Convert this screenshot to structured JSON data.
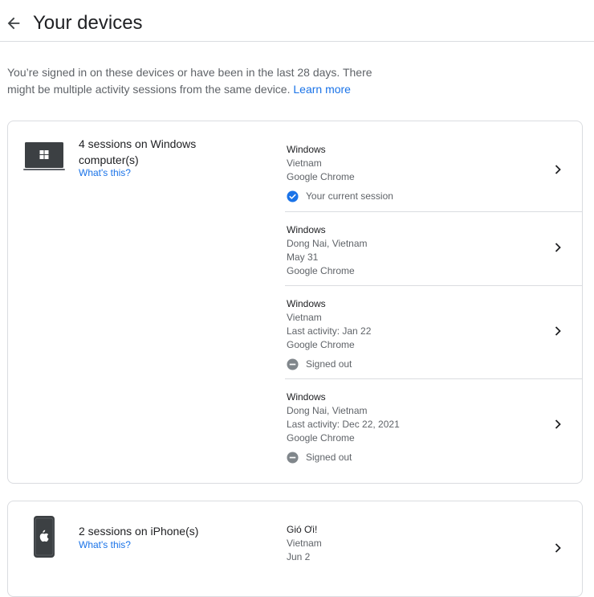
{
  "header": {
    "title": "Your devices"
  },
  "intro": {
    "text": "You’re signed in on these devices or have been in the last 28 days. There might be multiple activity sessions from the same device. ",
    "learn_more": "Learn more"
  },
  "devices": [
    {
      "title": "4 sessions on Windows computer(s)",
      "whats_this": "What's this?",
      "icon": "laptop-windows-icon",
      "sessions": [
        {
          "os": "Windows",
          "lines": [
            "Vietnam",
            "Google Chrome"
          ],
          "status": "Your current session",
          "status_icon": "check-circle-icon"
        },
        {
          "os": "Windows",
          "lines": [
            "Dong Nai, Vietnam",
            "May 31",
            "Google Chrome"
          ]
        },
        {
          "os": "Windows",
          "lines": [
            "Vietnam",
            "Last activity: Jan 22",
            "Google Chrome"
          ],
          "status": "Signed out",
          "status_icon": "minus-circle-icon"
        },
        {
          "os": "Windows",
          "lines": [
            "Dong Nai, Vietnam",
            "Last activity: Dec 22, 2021",
            "Google Chrome"
          ],
          "status": "Signed out",
          "status_icon": "minus-circle-icon"
        }
      ]
    },
    {
      "title": "2 sessions on iPhone(s)",
      "whats_this": "What's this?",
      "icon": "iphone-icon",
      "sessions": [
        {
          "os": "Gió Ơi!",
          "lines": [
            "Vietnam",
            "Jun 2"
          ]
        }
      ]
    }
  ],
  "colors": {
    "link": "#1a73e8",
    "check": "#1a73e8",
    "signed_out": "#80868b",
    "divider": "#dadce0"
  }
}
